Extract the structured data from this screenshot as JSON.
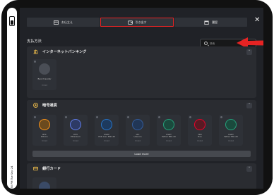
{
  "tabs": [
    {
      "label": "お仕立え",
      "icon": "card-icon"
    },
    {
      "label": "引き出す",
      "icon": "wallet-icon"
    },
    {
      "label": "履歴",
      "icon": "calendar-icon"
    }
  ],
  "active_tab_index": 1,
  "page_title": "支払方法",
  "search": {
    "placeholder": "検索"
  },
  "status_bar": {
    "text": "4:50 PM  Tue Sep 24"
  },
  "sections": {
    "internet_banking": {
      "title": "インターネットバンキング",
      "methods": [
        {
          "name": "Bank transfer",
          "range": "¥ limit"
        }
      ]
    },
    "crypto": {
      "title": "暗号通貨",
      "methods": [
        {
          "name": "BTC",
          "sub": "Bitcoin",
          "range": "¥ limit",
          "color": "#f7931a"
        },
        {
          "name": "ETH",
          "sub": "Ethereum",
          "range": "¥ limit",
          "color": "#627eea"
        },
        {
          "name": "USDC",
          "sub": "USD Coin ERC-20",
          "range": "¥ limit",
          "color": "#2775ca"
        },
        {
          "name": "LTC",
          "sub": "Litecoin",
          "range": "¥ limit",
          "color": "#345d9d"
        },
        {
          "name": "USDT",
          "sub": "Tether ERC-20",
          "range": "¥ limit",
          "color": "#26a17b"
        },
        {
          "name": "TRX",
          "sub": "Tron",
          "range": "¥ limit",
          "color": "#eb0029"
        },
        {
          "name": "USDT",
          "sub": "Tether TRC-20",
          "range": "¥ limit",
          "color": "#26a17b"
        }
      ],
      "load_more_label": "Load more"
    },
    "bank_card": {
      "title": "銀行カード"
    }
  },
  "colors": {
    "accent_red": "#e62323",
    "surface": "#2a2c31",
    "background": "#202227"
  }
}
